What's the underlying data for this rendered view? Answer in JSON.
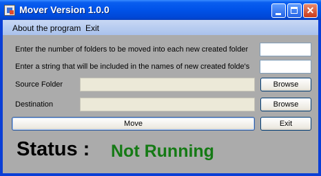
{
  "window": {
    "title": "Mover Version 1.0.0"
  },
  "menu": {
    "about": "About the program",
    "exit": "Exit"
  },
  "form": {
    "folders_count_label": "Enter the number of folders to be moved into each new created folder",
    "folders_count_value": "",
    "name_string_label": "Enter a string that will be included in the names of new created folde's",
    "name_string_value": "",
    "source_label": "Source Folder",
    "source_value": "",
    "source_browse": "Browse",
    "destination_label": "Destination",
    "destination_value": "",
    "destination_browse": "Browse",
    "move_button": "Move",
    "exit_button": "Exit"
  },
  "status": {
    "label": "Status :",
    "value": "Not Running",
    "value_color": "#157a15"
  },
  "icons": {
    "app": "app-icon",
    "minimize": "minimize-icon",
    "maximize": "maximize-icon",
    "close": "close-icon"
  }
}
